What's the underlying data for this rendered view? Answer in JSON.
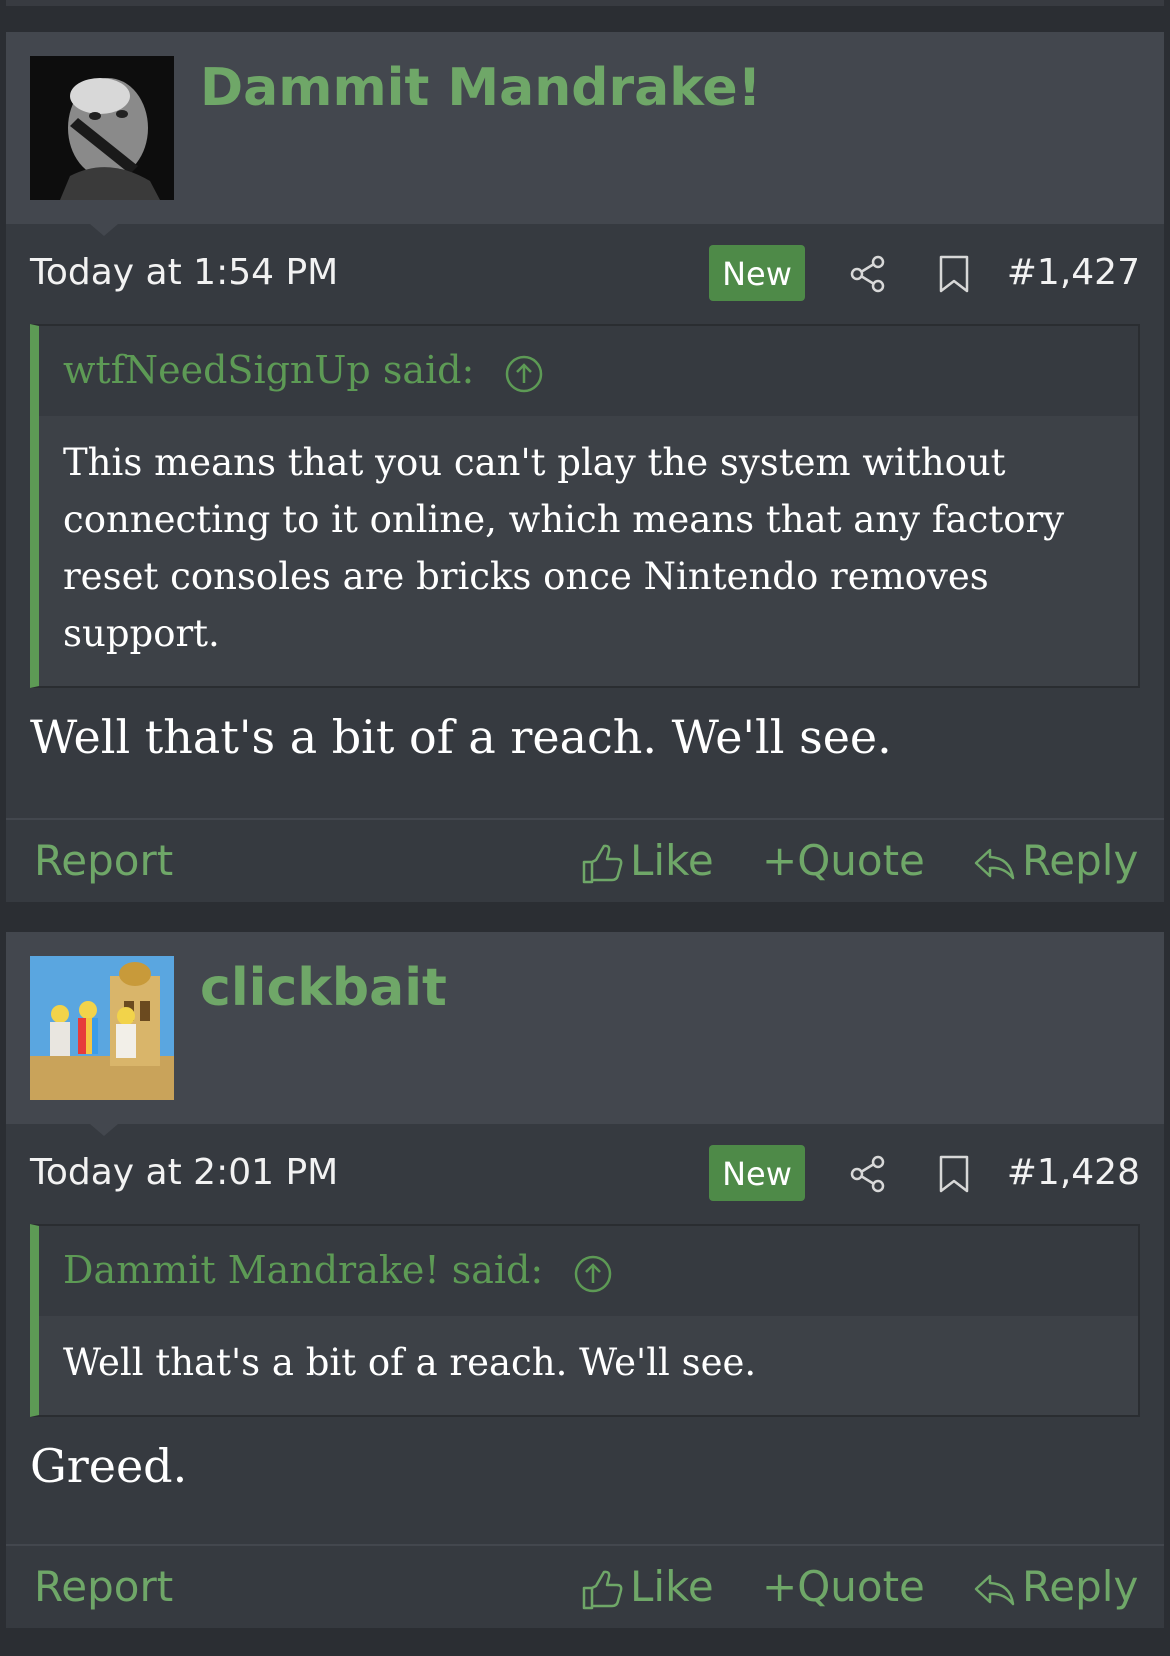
{
  "posts": [
    {
      "username": "Dammit Mandrake!",
      "date": "Today at 1:54 PM",
      "badge": "New",
      "number": "#1,427",
      "quote_author": "wtfNeedSignUp said:",
      "quote_body": "This means that you can't play the system without connecting to it online, which means that any factory reset consoles are bricks once Nintendo removes support.",
      "message": "Well that's a bit of a reach. We'll see."
    },
    {
      "username": "clickbait",
      "date": "Today at 2:01 PM",
      "badge": "New",
      "number": "#1,428",
      "quote_author": "Dammit Mandrake! said:",
      "quote_body": "Well that's a bit of a reach. We'll see.",
      "message": "Greed."
    }
  ],
  "actions": {
    "report": "Report",
    "like": "Like",
    "quote": "Quote",
    "quote_prefix": "+",
    "reply": "Reply"
  },
  "colors": {
    "accent": "#6fa768",
    "badge": "#4e8a48",
    "background": "#2b2e33"
  }
}
